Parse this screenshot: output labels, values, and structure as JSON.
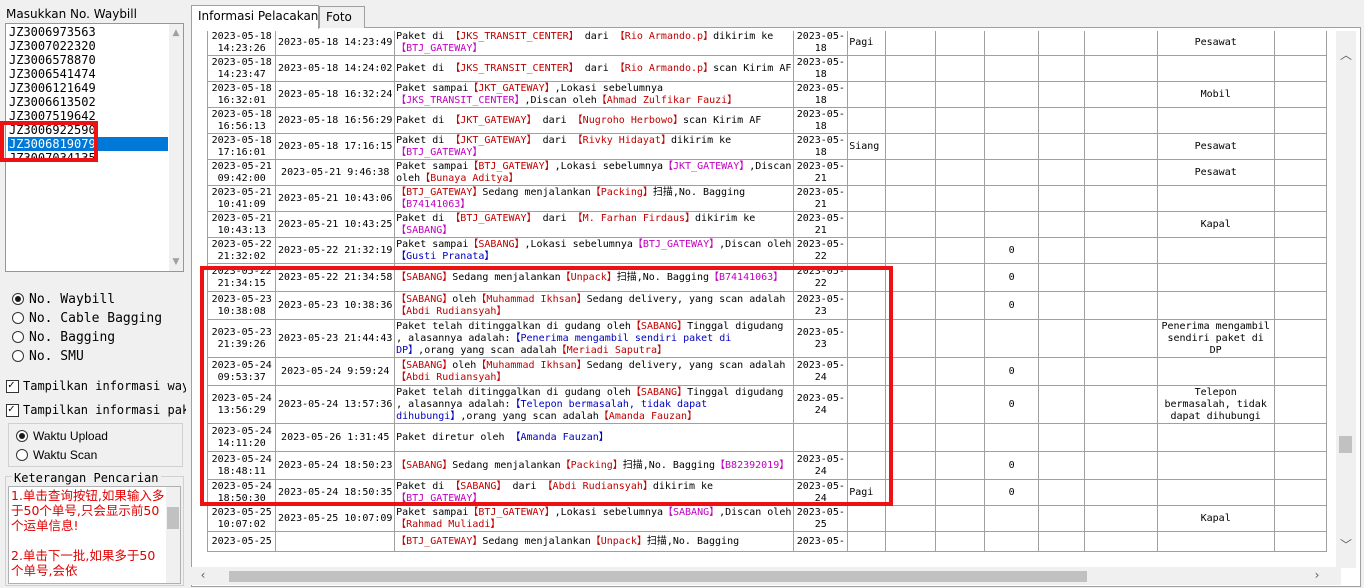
{
  "left": {
    "title": "Masukkan No. Waybill",
    "waybills": [
      "JZ3006973563",
      "JZ3007022320",
      "JZ3006578870",
      "JZ3006541474",
      "JZ3006121649",
      "JZ3006613502",
      "JZ3007519642",
      "JZ3006922590",
      "JZ3006819079",
      "JZ3007034135"
    ],
    "selected_index": 8,
    "search_types": [
      {
        "label": "No. Waybill",
        "checked": true
      },
      {
        "label": "No. Cable Bagging",
        "checked": false
      },
      {
        "label": "No. Bagging",
        "checked": false
      },
      {
        "label": "No. SMU",
        "checked": false
      }
    ],
    "checkboxes": [
      {
        "label": "Tampilkan informasi way",
        "checked": true
      },
      {
        "label": "Tampilkan informasi pak",
        "checked": true
      }
    ],
    "time_options": [
      {
        "label": "Waktu Upload",
        "checked": true
      },
      {
        "label": "Waktu Scan",
        "checked": false
      }
    ],
    "note_title": "Keterangan Pencarian",
    "notes": [
      "1.单击查询按钮,如果输入多于50个单号,只会显示前50个运单信息!",
      "2.单击下一批,如果多于50个单号,会依"
    ]
  },
  "tabs": [
    {
      "label": "Informasi Pelacakan",
      "active": true
    },
    {
      "label": "Foto",
      "active": false
    }
  ],
  "colors": {
    "red": "#c00000",
    "magenta": "#c000c0",
    "blue": "#0000c0",
    "highlight": "#ee1111"
  },
  "grid": {
    "rows": [
      {
        "t1": "2023-05-18 14:23:26",
        "t2": "2023-05-18 14:23:49",
        "desc": [
          [
            "Paket di ",
            ""
          ],
          [
            "【JKS_TRANSIT_CENTER】",
            "r"
          ],
          [
            " dari ",
            ""
          ],
          [
            "【Rio Armando.p】",
            "r"
          ],
          [
            "dikirim ke ",
            ""
          ],
          [
            "【BTJ_GATEWAY】",
            "m"
          ]
        ],
        "d": "2023-05-18",
        "e": "Pagi",
        "f": "",
        "g": "",
        "h": "",
        "i": "",
        "j": "Pesawat"
      },
      {
        "t1": "2023-05-18 14:23:47",
        "t2": "2023-05-18 14:24:02",
        "desc": [
          [
            "Paket di ",
            ""
          ],
          [
            "【JKS_TRANSIT_CENTER】",
            "r"
          ],
          [
            " dari ",
            ""
          ],
          [
            "【Rio Armando.p】",
            "r"
          ],
          [
            "scan Kirim AF",
            ""
          ]
        ],
        "d": "2023-05-18",
        "e": "",
        "f": "",
        "g": "",
        "h": "",
        "i": "",
        "j": ""
      },
      {
        "t1": "2023-05-18 16:32:01",
        "t2": "2023-05-18 16:32:24",
        "desc": [
          [
            "Paket sampai",
            ""
          ],
          [
            "【JKT_GATEWAY】",
            "r"
          ],
          [
            ",Lokasi sebelumnya ",
            ""
          ],
          [
            "【JKS_TRANSIT_CENTER】",
            "m"
          ],
          [
            ",Discan oleh",
            ""
          ],
          [
            "【Ahmad Zulfikar Fauzi】",
            "r"
          ]
        ],
        "d": "2023-05-18",
        "e": "",
        "f": "",
        "g": "",
        "h": "",
        "i": "",
        "j": "Mobil"
      },
      {
        "t1": "2023-05-18 16:56:13",
        "t2": "2023-05-18 16:56:29",
        "desc": [
          [
            "Paket di ",
            ""
          ],
          [
            "【JKT_GATEWAY】",
            "r"
          ],
          [
            " dari ",
            ""
          ],
          [
            "【Nugroho Herbowo】",
            "r"
          ],
          [
            "scan Kirim AF",
            ""
          ]
        ],
        "d": "2023-05-18",
        "e": "",
        "f": "",
        "g": "",
        "h": "",
        "i": "",
        "j": ""
      },
      {
        "t1": "2023-05-18 17:16:01",
        "t2": "2023-05-18 17:16:15",
        "desc": [
          [
            "Paket di ",
            ""
          ],
          [
            "【JKT_GATEWAY】",
            "r"
          ],
          [
            " dari ",
            ""
          ],
          [
            "【Rivky Hidayat】",
            "r"
          ],
          [
            "dikirim ke ",
            ""
          ],
          [
            "【BTJ_GATEWAY】",
            "m"
          ]
        ],
        "d": "2023-05-18",
        "e": "Siang",
        "f": "",
        "g": "",
        "h": "",
        "i": "",
        "j": "Pesawat"
      },
      {
        "t1": "2023-05-21 09:42:00",
        "t2": "2023-05-21 9:46:38",
        "desc": [
          [
            "Paket sampai",
            ""
          ],
          [
            "【BTJ_GATEWAY】",
            "r"
          ],
          [
            ",Lokasi sebelumnya",
            ""
          ],
          [
            "【JKT_GATEWAY】",
            "m"
          ],
          [
            ",Discan oleh",
            ""
          ],
          [
            "【Bunaya Aditya】",
            "r"
          ]
        ],
        "d": "2023-05-21",
        "e": "",
        "f": "",
        "g": "",
        "h": "",
        "i": "",
        "j": "Pesawat"
      },
      {
        "t1": "2023-05-21 10:41:09",
        "t2": "2023-05-21 10:43:06",
        "desc": [
          [
            "【BTJ_GATEWAY】",
            "r"
          ],
          [
            "Sedang menjalankan",
            ""
          ],
          [
            "【Packing】",
            "r"
          ],
          [
            "扫描,No. Bagging",
            ""
          ],
          [
            "【B74141063】",
            "m"
          ]
        ],
        "d": "2023-05-21",
        "e": "",
        "f": "",
        "g": "",
        "h": "",
        "i": "",
        "j": ""
      },
      {
        "t1": "2023-05-21 10:43:13",
        "t2": "2023-05-21 10:43:25",
        "desc": [
          [
            "Paket di ",
            ""
          ],
          [
            "【BTJ_GATEWAY】",
            "r"
          ],
          [
            " dari ",
            ""
          ],
          [
            "【M. Farhan Firdaus】",
            "r"
          ],
          [
            "dikirim ke",
            ""
          ],
          [
            "【SABANG】",
            "m"
          ]
        ],
        "d": "2023-05-21",
        "e": "",
        "f": "",
        "g": "",
        "h": "",
        "i": "",
        "j": "Kapal"
      },
      {
        "t1": "2023-05-22 21:32:02",
        "t2": "2023-05-22 21:32:19",
        "desc": [
          [
            "Paket sampai",
            ""
          ],
          [
            "【SABANG】",
            "r"
          ],
          [
            ",Lokasi sebelumnya",
            ""
          ],
          [
            "【BTJ_GATEWAY】",
            "m"
          ],
          [
            ",Discan oleh",
            ""
          ],
          [
            "【Gusti Pranata】",
            "b"
          ]
        ],
        "d": "2023-05-22",
        "e": "",
        "f": "",
        "g": "",
        "h": "0",
        "i": "",
        "j": ""
      },
      {
        "t1": "2023-05-22 21:34:15",
        "t2": "2023-05-22 21:34:58",
        "desc": [
          [
            "【SABANG】",
            "r"
          ],
          [
            "Sedang menjalankan",
            ""
          ],
          [
            "【Unpack】",
            "r"
          ],
          [
            "扫描,No. Bagging",
            ""
          ],
          [
            "【B74141063】",
            "m"
          ]
        ],
        "d": "2023-05-22",
        "e": "",
        "f": "",
        "g": "",
        "h": "0",
        "i": "",
        "j": ""
      },
      {
        "t1": "2023-05-23 10:38:08",
        "t2": "2023-05-23 10:38:36",
        "desc": [
          [
            "【SABANG】",
            "r"
          ],
          [
            "oleh",
            ""
          ],
          [
            "【Muhammad Ikhsan】",
            "r"
          ],
          [
            "Sedang delivery, yang scan adalah",
            ""
          ],
          [
            "【Abdi Rudiansyah】",
            "r"
          ]
        ],
        "d": "2023-05-23",
        "e": "",
        "f": "",
        "g": "",
        "h": "0",
        "i": "",
        "j": ""
      },
      {
        "t1": "2023-05-23 21:39:26",
        "t2": "2023-05-23 21:44:43",
        "desc": [
          [
            "Paket telah ditinggalkan di gudang oleh",
            ""
          ],
          [
            "【SABANG】",
            "r"
          ],
          [
            "Tinggal digudang , alasannya adalah:",
            ""
          ],
          [
            "【Penerima mengambil sendiri paket di DP】",
            "b"
          ],
          [
            ",orang yang scan adalah",
            ""
          ],
          [
            "【Meriadi Saputra】",
            "r"
          ]
        ],
        "d": "2023-05-23",
        "e": "",
        "f": "",
        "g": "",
        "h": "",
        "i": "",
        "j": "Penerima mengambil sendiri paket di DP"
      },
      {
        "t1": "2023-05-24 09:53:37",
        "t2": "2023-05-24 9:59:24",
        "desc": [
          [
            "【SABANG】",
            "r"
          ],
          [
            "oleh",
            ""
          ],
          [
            "【Muhammad Ikhsan】",
            "r"
          ],
          [
            "Sedang delivery, yang scan adalah",
            ""
          ],
          [
            "【Abdi Rudiansyah】",
            "r"
          ]
        ],
        "d": "2023-05-24",
        "e": "",
        "f": "",
        "g": "",
        "h": "0",
        "i": "",
        "j": ""
      },
      {
        "t1": "2023-05-24 13:56:29",
        "t2": "2023-05-24 13:57:36",
        "desc": [
          [
            "Paket telah ditinggalkan di gudang oleh",
            ""
          ],
          [
            "【SABANG】",
            "r"
          ],
          [
            "Tinggal digudang , alasannya adalah:",
            ""
          ],
          [
            "【Telepon bermasalah, tidak dapat dihubungi】",
            "b"
          ],
          [
            ",orang yang scan adalah",
            ""
          ],
          [
            "【Amanda Fauzan】",
            "r"
          ]
        ],
        "d": "2023-05-24",
        "e": "",
        "f": "",
        "g": "",
        "h": "0",
        "i": "",
        "j": "Telepon bermasalah, tidak dapat dihubungi"
      },
      {
        "t1": "2023-05-24 14:11:20",
        "t2": "2023-05-26 1:31:45",
        "desc": [
          [
            "Paket diretur oleh ",
            ""
          ],
          [
            "【Amanda Fauzan】",
            "b"
          ]
        ],
        "d": "",
        "e": "",
        "f": "",
        "g": "",
        "h": "",
        "i": "",
        "j": ""
      },
      {
        "t1": "2023-05-24 18:48:11",
        "t2": "2023-05-24 18:50:23",
        "desc": [
          [
            "【SABANG】",
            "r"
          ],
          [
            "Sedang menjalankan",
            ""
          ],
          [
            "【Packing】",
            "r"
          ],
          [
            "扫描,No. Bagging",
            ""
          ],
          [
            "【B82392019】",
            "m"
          ]
        ],
        "d": "2023-05-24",
        "e": "",
        "f": "",
        "g": "",
        "h": "0",
        "i": "",
        "j": ""
      },
      {
        "t1": "2023-05-24 18:50:30",
        "t2": "2023-05-24 18:50:35",
        "desc": [
          [
            "Paket di ",
            ""
          ],
          [
            "【SABANG】",
            "r"
          ],
          [
            " dari ",
            ""
          ],
          [
            "【Abdi Rudiansyah】",
            "r"
          ],
          [
            "dikirim ke",
            ""
          ],
          [
            "【BTJ_GATEWAY】",
            "m"
          ]
        ],
        "d": "2023-05-24",
        "e": "Pagi",
        "f": "",
        "g": "",
        "h": "0",
        "i": "",
        "j": ""
      },
      {
        "t1": "2023-05-25 10:07:02",
        "t2": "2023-05-25 10:07:09",
        "desc": [
          [
            "Paket sampai",
            ""
          ],
          [
            "【BTJ_GATEWAY】",
            "r"
          ],
          [
            ",Lokasi sebelumnya",
            ""
          ],
          [
            "【SABANG】",
            "m"
          ],
          [
            ",Discan oleh",
            ""
          ],
          [
            "【Rahmad Muliadi】",
            "r"
          ]
        ],
        "d": "2023-05-25",
        "e": "",
        "f": "",
        "g": "",
        "h": "",
        "i": "",
        "j": "Kapal"
      },
      {
        "t1": "2023-05-25",
        "t2": "",
        "desc": [
          [
            "【BTJ_GATEWAY】",
            "r"
          ],
          [
            "Sedang menjalankan",
            ""
          ],
          [
            "【Unpack】",
            "r"
          ],
          [
            "扫描,No. Bagging",
            ""
          ]
        ],
        "d": "2023-05-",
        "e": "",
        "f": "",
        "g": "",
        "h": "",
        "i": "",
        "j": ""
      }
    ]
  }
}
